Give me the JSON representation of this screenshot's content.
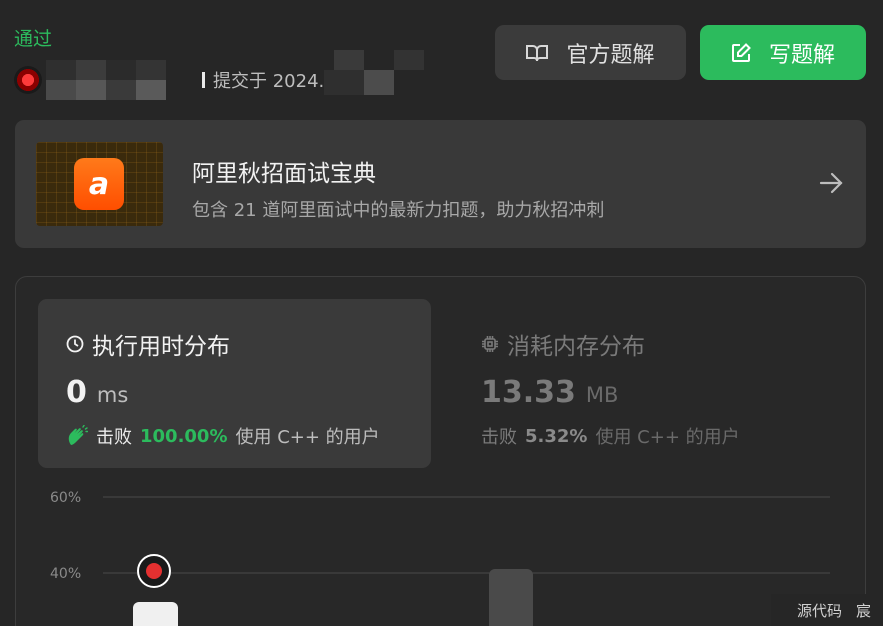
{
  "header": {
    "status": "通过",
    "submit_text": "提交于 2024."
  },
  "buttons": {
    "official": "官方题解",
    "write": "写题解"
  },
  "promo": {
    "logo_text": "a",
    "title": "阿里秋招面试宝典",
    "subtitle": "包含 21 道阿里面试中的最新力扣题，助力秋招冲刺"
  },
  "runtime": {
    "title": "执行用时分布",
    "value": "0",
    "unit": "ms",
    "beats_label": "击败",
    "beats_pct": "100.00%",
    "beats_rest": "使用 C++ 的用户"
  },
  "memory": {
    "title": "消耗内存分布",
    "value": "13.33",
    "unit": "MB",
    "beats_label": "击败",
    "beats_pct": "5.32%",
    "beats_rest": "使用 C++ 的用户"
  },
  "chart_data": {
    "type": "bar",
    "y_ticks": [
      "60%",
      "40%"
    ],
    "ylim": [
      0,
      60
    ]
  },
  "footer": {
    "source_code": "源代码",
    "user_initial": "宸"
  },
  "colors": {
    "accent": "#2cbb5d",
    "background": "#262626",
    "panel": "#393939"
  }
}
